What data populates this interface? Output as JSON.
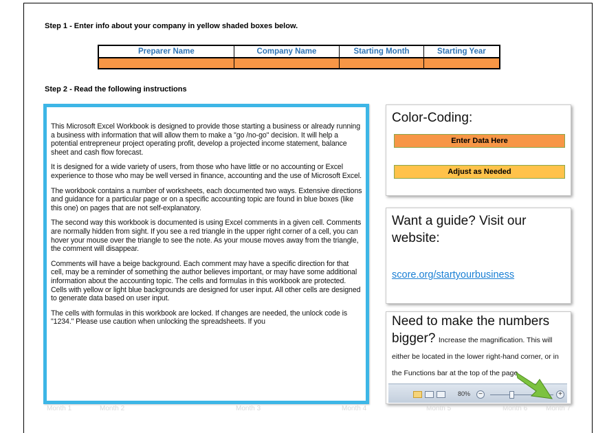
{
  "step1": "Step 1 - Enter info about your company in yellow shaded boxes below.",
  "step2": "Step 2 - Read the following instructions",
  "table": {
    "headers": [
      "Preparer Name",
      "Company Name",
      "Starting Month",
      "Starting Year"
    ]
  },
  "instructions": {
    "paragraphs": [
      "This Microsoft Excel Workbook is designed to provide those starting a business or already running a business with information that will allow them to make a \"go /no-go\" decision. It will help a potential entrepreneur project operating profit, develop a projected income statement, balance sheet and cash flow forecast.",
      "It is designed for a wide variety of users, from those who have little or no accounting or Excel experience to those who may be well versed in finance, accounting and the use of Microsoft Excel.",
      "The workbook contains a number of worksheets, each documented two ways. Extensive directions and guidance for a particular page or on a specific accounting topic are found in blue boxes (like this one) on pages that are not self-explanatory.",
      "The second way this workbook is documented is using Excel comments in a given cell. Comments are normally hidden from sight. If you see a red triangle in the upper right corner of a cell, you can hover your mouse over the triangle to see the note. As your mouse moves away from the triangle, the comment will disappear.",
      "Comments will have a beige background. Each comment may have a specific direction for that cell, may be a reminder of something the author believes important, or may have some additional information about the accounting topic. The cells and formulas in this workbook are protected. Cells with yellow or light blue backgrounds are designed for user input. All other cells are designed to generate data based on user input.",
      "The cells with formulas in this workbook are locked. If changes are needed, the unlock code is \"1234.\" Please use caution when unlocking the spreadsheets. If you"
    ]
  },
  "color_coding": {
    "title": "Color-Coding:",
    "enter": "Enter Data Here",
    "adjust": "Adjust as Needed",
    "colors": {
      "enter": "#f79646",
      "adjust": "#ffc24a"
    }
  },
  "guide": {
    "title": "Want a guide? Visit our website:",
    "link": "score.org/startyourbusiness"
  },
  "zoom_card": {
    "title": "Need to make the numbers bigger?",
    "body": "Increase the magnification. This will either be located in the lower right-hand corner, or in the Functions bar at the top of the page.",
    "zoom_level": "80%"
  },
  "months": [
    "Month 1",
    "Month 2",
    "Month 3",
    "Month 4",
    "Month 5",
    "Month 6",
    "Month 7"
  ]
}
